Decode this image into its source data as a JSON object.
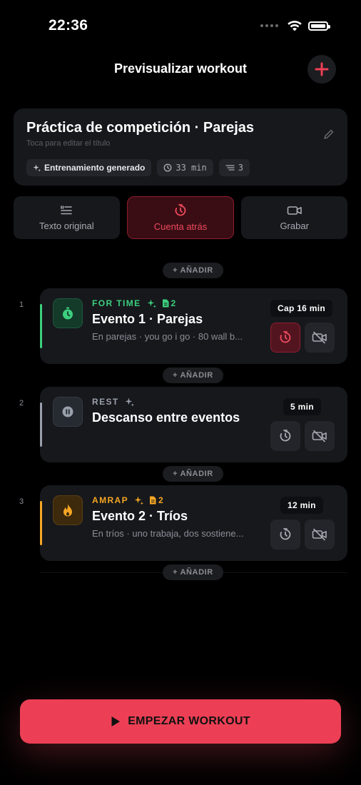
{
  "status_bar": {
    "time": "22:36"
  },
  "header": {
    "title": "Previsualizar workout"
  },
  "workout": {
    "title": "Práctica de competición · Parejas",
    "subtitle": "Toca para editar el título",
    "chips": {
      "generated": "Entrenamiento generado",
      "duration": "33 min",
      "count": "3"
    }
  },
  "modes": [
    {
      "label": "Texto original",
      "icon": "quote-list-icon",
      "active": false
    },
    {
      "label": "Cuenta atrás",
      "icon": "countdown-timer-icon",
      "active": true
    },
    {
      "label": "Grabar",
      "icon": "video-camera-icon",
      "active": false
    }
  ],
  "add_label": "+ AÑADIR",
  "events": [
    {
      "index": "1",
      "type": "FOR TIME",
      "attachments": "2",
      "name": "Evento 1 · Parejas",
      "description": "En parejas · you go i go · 80 wall b...",
      "cap": "Cap 16 min",
      "accent": "#3ccf7e",
      "icon": "stopwatch-icon",
      "countdown_active": true
    },
    {
      "index": "2",
      "type": "REST",
      "attachments": "",
      "name": "Descanso entre eventos",
      "description": "",
      "cap": "5 min",
      "accent": "#9aa0ab",
      "icon": "pause-icon",
      "countdown_active": false
    },
    {
      "index": "3",
      "type": "AMRAP",
      "attachments": "2",
      "name": "Evento 2 · Tríos",
      "description": "En tríos · uno trabaja, dos sostiene...",
      "cap": "12 min",
      "accent": "#f5a623",
      "icon": "flame-icon",
      "countdown_active": false
    }
  ],
  "start_button": {
    "label": "EMPEZAR WORKOUT"
  },
  "colors": {
    "accent_red": "#ec3f55",
    "background": "#000000",
    "card": "#16181c"
  }
}
